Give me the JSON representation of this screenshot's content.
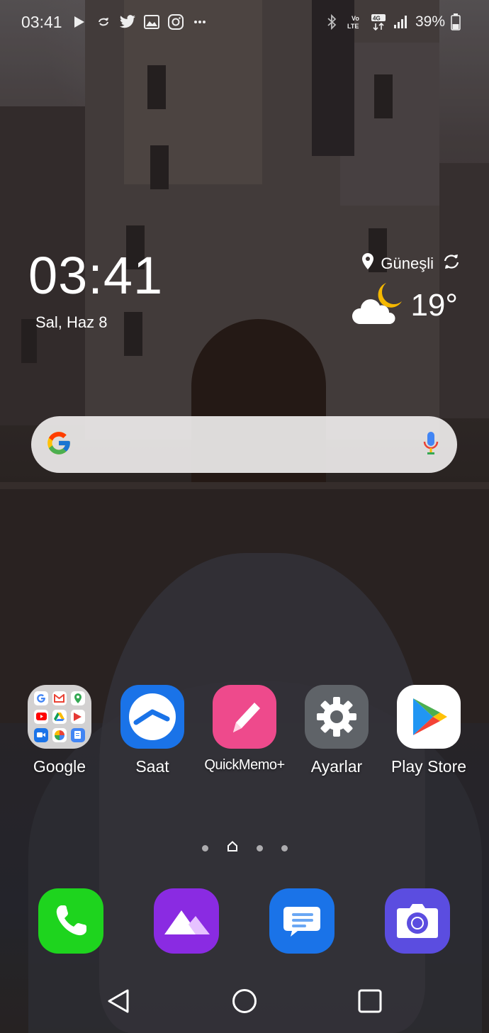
{
  "status_bar": {
    "time": "03:41",
    "left_icons": [
      "play-icon",
      "sync-icon",
      "twitter-icon",
      "gallery-icon",
      "instagram-icon",
      "more-icon"
    ],
    "right_icons": [
      "bluetooth-icon",
      "volte-icon",
      "4g-icon",
      "signal-icon",
      "battery-icon"
    ],
    "volte_label": "Vo\nLTE",
    "network_label": "4G",
    "battery_percent": "39%",
    "battery_level": 0.39
  },
  "clock_widget": {
    "time": "03:41",
    "date": "Sal, Haz 8"
  },
  "weather_widget": {
    "location": "Güneşli",
    "temperature": "19°",
    "condition_icon": "cloud-moon-icon"
  },
  "search_bar": {
    "logo_icon": "google-g-icon",
    "mic_icon": "microphone-icon"
  },
  "apps": [
    {
      "label": "Google",
      "icon": "google-folder-icon"
    },
    {
      "label": "Saat",
      "icon": "clock-app-icon"
    },
    {
      "label": "QuickMemo+",
      "icon": "quickmemo-icon"
    },
    {
      "label": "Ayarlar",
      "icon": "settings-gear-icon"
    },
    {
      "label": "Play Store",
      "icon": "play-store-icon"
    }
  ],
  "page_indicator": {
    "pages": 4,
    "current": 1,
    "home_page": 1
  },
  "dock": [
    {
      "icon": "phone-icon",
      "color": "#1ed41e"
    },
    {
      "icon": "gallery-app-icon",
      "color": "#8a2be2"
    },
    {
      "icon": "messages-icon",
      "color": "#1a73e8"
    },
    {
      "icon": "camera-icon",
      "color": "#5b4de0"
    }
  ],
  "nav_bar": {
    "buttons": [
      "back-icon",
      "home-icon",
      "recents-icon"
    ]
  },
  "colors": {
    "saat_bg": "#1a73e8",
    "quickmemo_bg": "#ee4a8c",
    "ayarlar_bg": "#5f6368",
    "playstore_bg": "#ffffff"
  }
}
